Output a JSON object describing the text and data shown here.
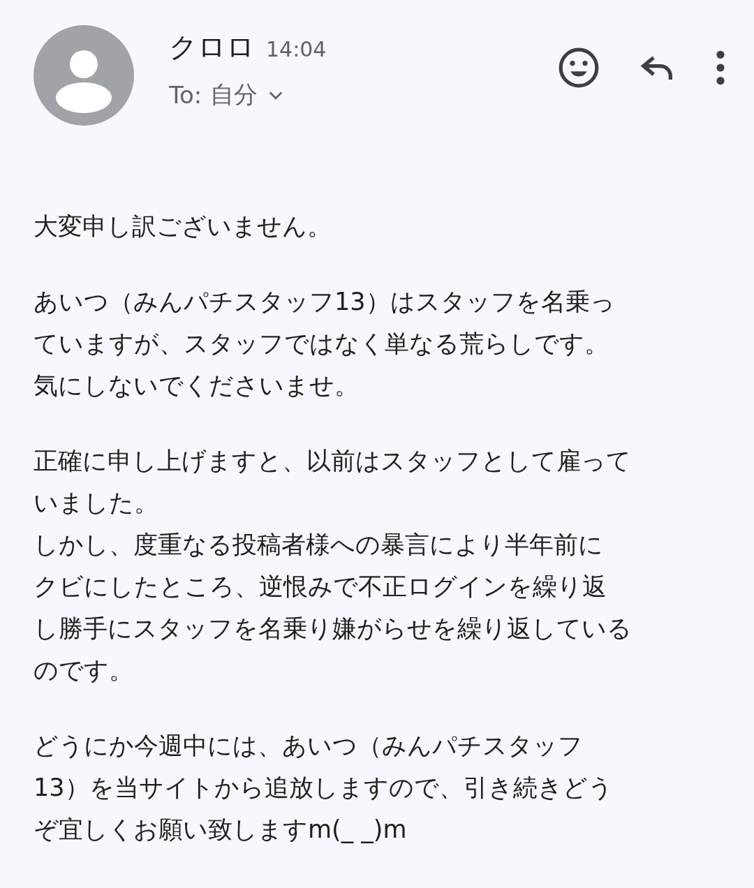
{
  "sender": {
    "name": "クロロ",
    "time": "14:04",
    "to_label": "To:",
    "recipient": "自分"
  },
  "body": [
    {
      "lines": [
        "大変申し訳ございません。"
      ]
    },
    {
      "lines": [
        "あいつ（みんパチスタッフ13）はスタッフを名乗っ",
        "ていますが、スタッフではなく単なる荒らしです。",
        "気にしないでくださいませ。"
      ]
    },
    {
      "lines": [
        "正確に申し上げますと、以前はスタッフとして雇って",
        "いました。",
        "しかし、度重なる投稿者様への暴言により半年前に",
        "クビにしたところ、逆恨みで不正ログインを繰り返",
        "し勝手にスタッフを名乗り嫌がらせを繰り返している",
        "のです。"
      ]
    },
    {
      "lines": [
        "どうにか今週中には、あいつ（みんパチスタッフ",
        "13）を当サイトから追放しますので、引き続きどう",
        "ぞ宜しくお願い致しますm(_ _)m"
      ]
    }
  ]
}
